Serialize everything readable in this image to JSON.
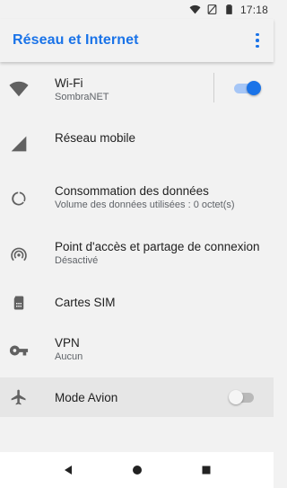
{
  "status_bar": {
    "time": "17:18",
    "icons": [
      "wifi-icon",
      "no-sim-icon",
      "battery-icon"
    ]
  },
  "app_bar": {
    "title": "Réseau et Internet",
    "menu_icon": "overflow-menu-icon"
  },
  "settings": {
    "wifi": {
      "label": "Wi-Fi",
      "summary": "SombraNET",
      "icon": "wifi-icon",
      "toggle_on": true
    },
    "mobile": {
      "label": "Réseau mobile",
      "icon": "signal-icon"
    },
    "data_usage": {
      "label": "Consommation des données",
      "summary": "Volume des données utilisées : 0 octet(s)",
      "icon": "data-usage-icon"
    },
    "hotspot": {
      "label": "Point d'accès et partage de connexion",
      "summary": "Désactivé",
      "icon": "hotspot-icon"
    },
    "sim": {
      "label": "Cartes SIM",
      "icon": "sim-card-icon"
    },
    "vpn": {
      "label": "VPN",
      "summary": "Aucun",
      "icon": "vpn-key-icon"
    },
    "airplane": {
      "label": "Mode Avion",
      "icon": "airplane-icon",
      "toggle_on": false
    }
  },
  "nav_bar": {
    "buttons": [
      "back-icon",
      "home-icon",
      "recents-icon"
    ]
  },
  "colors": {
    "accent": "#1a73e8",
    "background": "#f2f2f2",
    "icon": "#616161"
  }
}
